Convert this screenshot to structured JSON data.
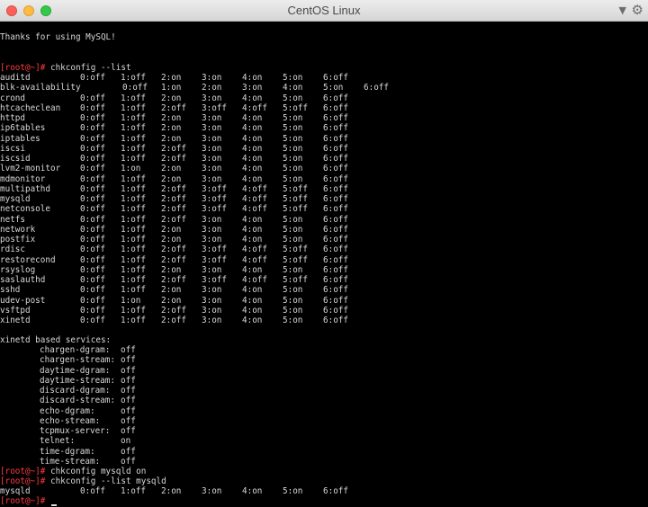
{
  "window": {
    "title": "CentOS Linux"
  },
  "terminal": {
    "thanks": "Thanks for using MySQL!",
    "prompt": "[root@~]#",
    "commands": {
      "list": "chkconfig --list",
      "mysqld_on": "chkconfig mysqld on",
      "list_mysqld": "chkconfig --list mysqld"
    },
    "services": [
      {
        "name": "auditd",
        "levels": [
          "0:off",
          "1:off",
          "2:on",
          "3:on",
          "4:on",
          "5:on",
          "6:off"
        ]
      },
      {
        "name": "blk-availability",
        "levels": [
          "0:off",
          "1:on",
          "2:on",
          "3:on",
          "4:on",
          "5:on",
          "6:off"
        ]
      },
      {
        "name": "crond",
        "levels": [
          "0:off",
          "1:off",
          "2:on",
          "3:on",
          "4:on",
          "5:on",
          "6:off"
        ]
      },
      {
        "name": "htcacheclean",
        "levels": [
          "0:off",
          "1:off",
          "2:off",
          "3:off",
          "4:off",
          "5:off",
          "6:off"
        ]
      },
      {
        "name": "httpd",
        "levels": [
          "0:off",
          "1:off",
          "2:on",
          "3:on",
          "4:on",
          "5:on",
          "6:off"
        ]
      },
      {
        "name": "ip6tables",
        "levels": [
          "0:off",
          "1:off",
          "2:on",
          "3:on",
          "4:on",
          "5:on",
          "6:off"
        ]
      },
      {
        "name": "iptables",
        "levels": [
          "0:off",
          "1:off",
          "2:on",
          "3:on",
          "4:on",
          "5:on",
          "6:off"
        ]
      },
      {
        "name": "iscsi",
        "levels": [
          "0:off",
          "1:off",
          "2:off",
          "3:on",
          "4:on",
          "5:on",
          "6:off"
        ]
      },
      {
        "name": "iscsid",
        "levels": [
          "0:off",
          "1:off",
          "2:off",
          "3:on",
          "4:on",
          "5:on",
          "6:off"
        ]
      },
      {
        "name": "lvm2-monitor",
        "levels": [
          "0:off",
          "1:on",
          "2:on",
          "3:on",
          "4:on",
          "5:on",
          "6:off"
        ]
      },
      {
        "name": "mdmonitor",
        "levels": [
          "0:off",
          "1:off",
          "2:on",
          "3:on",
          "4:on",
          "5:on",
          "6:off"
        ]
      },
      {
        "name": "multipathd",
        "levels": [
          "0:off",
          "1:off",
          "2:off",
          "3:off",
          "4:off",
          "5:off",
          "6:off"
        ]
      },
      {
        "name": "mysqld",
        "levels": [
          "0:off",
          "1:off",
          "2:off",
          "3:off",
          "4:off",
          "5:off",
          "6:off"
        ]
      },
      {
        "name": "netconsole",
        "levels": [
          "0:off",
          "1:off",
          "2:off",
          "3:off",
          "4:off",
          "5:off",
          "6:off"
        ]
      },
      {
        "name": "netfs",
        "levels": [
          "0:off",
          "1:off",
          "2:off",
          "3:on",
          "4:on",
          "5:on",
          "6:off"
        ]
      },
      {
        "name": "network",
        "levels": [
          "0:off",
          "1:off",
          "2:on",
          "3:on",
          "4:on",
          "5:on",
          "6:off"
        ]
      },
      {
        "name": "postfix",
        "levels": [
          "0:off",
          "1:off",
          "2:on",
          "3:on",
          "4:on",
          "5:on",
          "6:off"
        ]
      },
      {
        "name": "rdisc",
        "levels": [
          "0:off",
          "1:off",
          "2:off",
          "3:off",
          "4:off",
          "5:off",
          "6:off"
        ]
      },
      {
        "name": "restorecond",
        "levels": [
          "0:off",
          "1:off",
          "2:off",
          "3:off",
          "4:off",
          "5:off",
          "6:off"
        ]
      },
      {
        "name": "rsyslog",
        "levels": [
          "0:off",
          "1:off",
          "2:on",
          "3:on",
          "4:on",
          "5:on",
          "6:off"
        ]
      },
      {
        "name": "saslauthd",
        "levels": [
          "0:off",
          "1:off",
          "2:off",
          "3:off",
          "4:off",
          "5:off",
          "6:off"
        ]
      },
      {
        "name": "sshd",
        "levels": [
          "0:off",
          "1:off",
          "2:on",
          "3:on",
          "4:on",
          "5:on",
          "6:off"
        ]
      },
      {
        "name": "udev-post",
        "levels": [
          "0:off",
          "1:on",
          "2:on",
          "3:on",
          "4:on",
          "5:on",
          "6:off"
        ]
      },
      {
        "name": "vsftpd",
        "levels": [
          "0:off",
          "1:off",
          "2:off",
          "3:on",
          "4:on",
          "5:on",
          "6:off"
        ]
      },
      {
        "name": "xinetd",
        "levels": [
          "0:off",
          "1:off",
          "2:off",
          "3:on",
          "4:on",
          "5:on",
          "6:off"
        ]
      }
    ],
    "xinetd_header": "xinetd based services:",
    "xinetd_services": [
      {
        "name": "chargen-dgram:",
        "state": "off"
      },
      {
        "name": "chargen-stream:",
        "state": "off"
      },
      {
        "name": "daytime-dgram:",
        "state": "off"
      },
      {
        "name": "daytime-stream:",
        "state": "off"
      },
      {
        "name": "discard-dgram:",
        "state": "off"
      },
      {
        "name": "discard-stream:",
        "state": "off"
      },
      {
        "name": "echo-dgram:",
        "state": "off"
      },
      {
        "name": "echo-stream:",
        "state": "off"
      },
      {
        "name": "tcpmux-server:",
        "state": "off"
      },
      {
        "name": "telnet:",
        "state": "on"
      },
      {
        "name": "time-dgram:",
        "state": "off"
      },
      {
        "name": "time-stream:",
        "state": "off"
      }
    ],
    "mysqld_result": {
      "name": "mysqld",
      "levels": [
        "0:off",
        "1:off",
        "2:on",
        "3:on",
        "4:on",
        "5:on",
        "6:off"
      ]
    },
    "colors": {
      "prompt": "#ff3b3b",
      "text": "#d8d8d8",
      "background": "#000000"
    }
  }
}
